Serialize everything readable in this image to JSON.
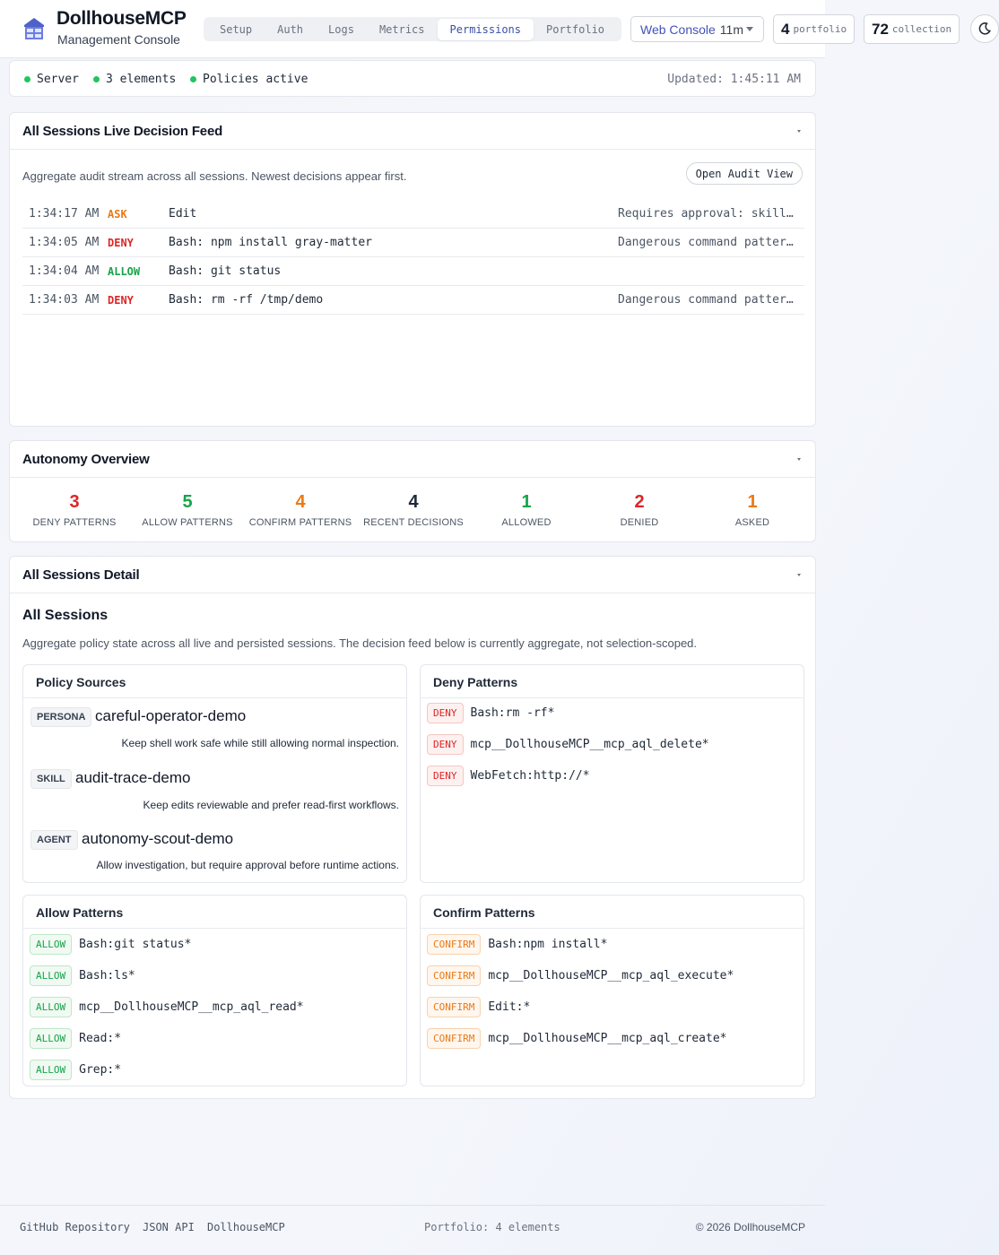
{
  "brand": {
    "title": "DollhouseMCP",
    "subtitle": "Management Console"
  },
  "tabs": [
    {
      "label": "Setup",
      "active": false
    },
    {
      "label": "Auth",
      "active": false
    },
    {
      "label": "Logs",
      "active": false
    },
    {
      "label": "Metrics",
      "active": false
    },
    {
      "label": "Permissions",
      "active": true
    },
    {
      "label": "Portfolio",
      "active": false
    }
  ],
  "console_select": {
    "name": "Web Console",
    "age": "11m"
  },
  "portfolio_stat": {
    "value": "4",
    "label": "portfolio"
  },
  "collection_stat": {
    "value": "72",
    "label": "collection"
  },
  "theme_icon": "moon-icon",
  "status": {
    "server": "Server",
    "elements": "3 elements",
    "policies": "Policies active",
    "updated": "Updated: 1:45:11 AM",
    "dot_color": "#22c55e"
  },
  "feed": {
    "title": "All Sessions Live Decision Feed",
    "description": "Aggregate audit stream across all sessions. Newest decisions appear first.",
    "audit_button": "Open Audit View",
    "rows": [
      {
        "time": "1:34:17 AM",
        "decision": "ASK",
        "action": "Edit",
        "reason": "Requires approval: skill '…"
      },
      {
        "time": "1:34:05 AM",
        "decision": "DENY",
        "action": "Bash: npm install gray-matter",
        "reason": "Dangerous command pattern:…"
      },
      {
        "time": "1:34:04 AM",
        "decision": "ALLOW",
        "action": "Bash: git status",
        "reason": ""
      },
      {
        "time": "1:34:03 AM",
        "decision": "DENY",
        "action": "Bash: rm -rf /tmp/demo",
        "reason": "Dangerous command pattern:…"
      }
    ]
  },
  "autonomy": {
    "title": "Autonomy Overview",
    "stats": [
      {
        "value": "3",
        "label": "DENY PATTERNS",
        "color": "#dc2626"
      },
      {
        "value": "5",
        "label": "ALLOW PATTERNS",
        "color": "#16a34a"
      },
      {
        "value": "4",
        "label": "CONFIRM PATTERNS",
        "color": "#ea7a16"
      },
      {
        "value": "4",
        "label": "RECENT DECISIONS",
        "color": "#1f2937"
      },
      {
        "value": "1",
        "label": "ALLOWED",
        "color": "#16a34a"
      },
      {
        "value": "2",
        "label": "DENIED",
        "color": "#dc2626"
      },
      {
        "value": "1",
        "label": "ASKED",
        "color": "#ea7a16"
      }
    ]
  },
  "detail": {
    "title": "All Sessions Detail",
    "subtitle": "All Sessions",
    "description": "Aggregate policy state across all live and persisted sessions. The decision feed below is currently aggregate, not selection-scoped.",
    "policy_sources": {
      "title": "Policy Sources",
      "items": [
        {
          "tag": "PERSONA",
          "name": "careful-operator-demo",
          "note": "Keep shell work safe while still allowing normal inspection."
        },
        {
          "tag": "SKILL",
          "name": "audit-trace-demo",
          "note": "Keep edits reviewable and prefer read-first workflows."
        },
        {
          "tag": "AGENT",
          "name": "autonomy-scout-demo",
          "note": "Allow investigation, but require approval before runtime actions."
        }
      ]
    },
    "deny_patterns": {
      "title": "Deny Patterns",
      "tag": "DENY",
      "items": [
        "Bash:rm -rf*",
        "mcp__DollhouseMCP__mcp_aql_delete*",
        "WebFetch:http://*"
      ]
    },
    "allow_patterns": {
      "title": "Allow Patterns",
      "tag": "ALLOW",
      "items": [
        "Bash:git status*",
        "Bash:ls*",
        "mcp__DollhouseMCP__mcp_aql_read*",
        "Read:*",
        "Grep:*"
      ]
    },
    "confirm_patterns": {
      "title": "Confirm Patterns",
      "tag": "CONFIRM",
      "items": [
        "Bash:npm install*",
        "mcp__DollhouseMCP__mcp_aql_execute*",
        "Edit:*",
        "mcp__DollhouseMCP__mcp_aql_create*"
      ]
    }
  },
  "footer": {
    "links": [
      "GitHub Repository",
      "JSON API",
      "DollhouseMCP"
    ],
    "portfolio": "Portfolio: 4 elements",
    "copyright": "© 2026 DollhouseMCP"
  }
}
